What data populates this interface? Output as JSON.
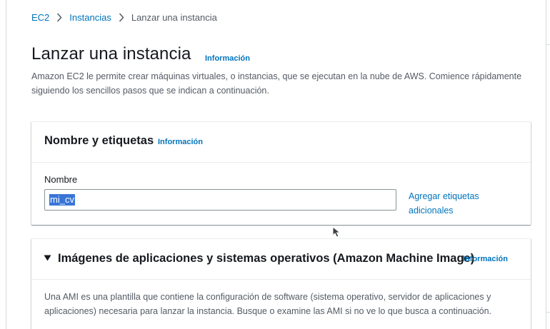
{
  "breadcrumb": {
    "items": [
      "EC2",
      "Instancias"
    ],
    "current": "Lanzar una instancia"
  },
  "header": {
    "title": "Lanzar una instancia",
    "info": "Información",
    "description": "Amazon EC2 le permite crear máquinas virtuales, o instancias, que se ejecutan en la nube de AWS. Comience rápidamente siguiendo los sencillos pasos que se indican a continuación."
  },
  "name_panel": {
    "title": "Nombre y etiquetas",
    "info": "Información",
    "field_label": "Nombre",
    "field_value": "mi_cv",
    "add_tags": "Agregar etiquetas adicionales"
  },
  "ami_panel": {
    "title": "Imágenes de aplicaciones y sistemas operativos (Amazon Machine Image)",
    "info": "Información",
    "description": "Una AMI es una plantilla que contiene la configuración de software (sistema operativo, servidor de aplicaciones y aplicaciones) necesaria para lanzar la instancia. Busque o examine las AMI si no ve lo que busca a continuación."
  },
  "colors": {
    "link": "#0073bb",
    "text": "#16191f",
    "muted": "#545b64",
    "selection": "#3875d7"
  },
  "icons": {
    "breadcrumb_separator": "chevron-right-icon",
    "expand": "caret-down-icon",
    "pointer": "mouse-cursor-icon"
  }
}
